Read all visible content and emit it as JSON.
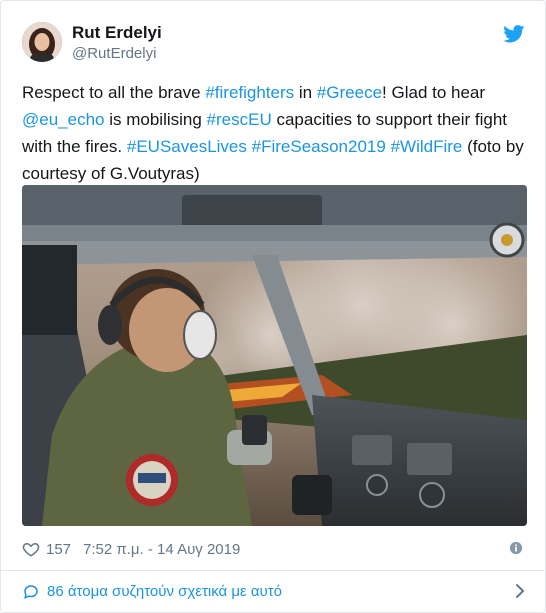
{
  "author": {
    "name": "Rut Erdelyi",
    "handle": "@RutErdelyi"
  },
  "tweet": {
    "segments": [
      {
        "text": "Respect to all the brave ",
        "link": false
      },
      {
        "text": "#firefighters",
        "link": true
      },
      {
        "text": " in ",
        "link": false
      },
      {
        "text": "#Greece",
        "link": true
      },
      {
        "text": "! Glad to hear ",
        "link": false
      },
      {
        "text": "@eu_echo",
        "link": true
      },
      {
        "text": " is mobilising ",
        "link": false
      },
      {
        "text": "#rescEU",
        "link": true
      },
      {
        "text": " capacities to support their fight with the fires. ",
        "link": false
      },
      {
        "text": "#EUSavesLives",
        "link": true
      },
      {
        "text": " ",
        "link": false
      },
      {
        "text": "#FireSeason2019",
        "link": true
      },
      {
        "text": " ",
        "link": false
      },
      {
        "text": "#WildFire",
        "link": true
      },
      {
        "text": " (foto by courtesy of  G.Voutyras)",
        "link": false
      }
    ]
  },
  "stats": {
    "likes": "157",
    "timestamp": "7:52 π.μ. - 14 Αυγ 2019"
  },
  "footer": {
    "conversation": "86 άτομα συζητούν σχετικά με αυτό"
  },
  "icons": {
    "brand": "twitter-bird-icon",
    "like": "heart-icon",
    "info": "info-icon",
    "reply": "speech-bubble-icon",
    "more": "chevron-right-icon"
  },
  "colors": {
    "link": "#1b95e0",
    "secondary_text": "#657786",
    "border": "#e1e8ed"
  }
}
